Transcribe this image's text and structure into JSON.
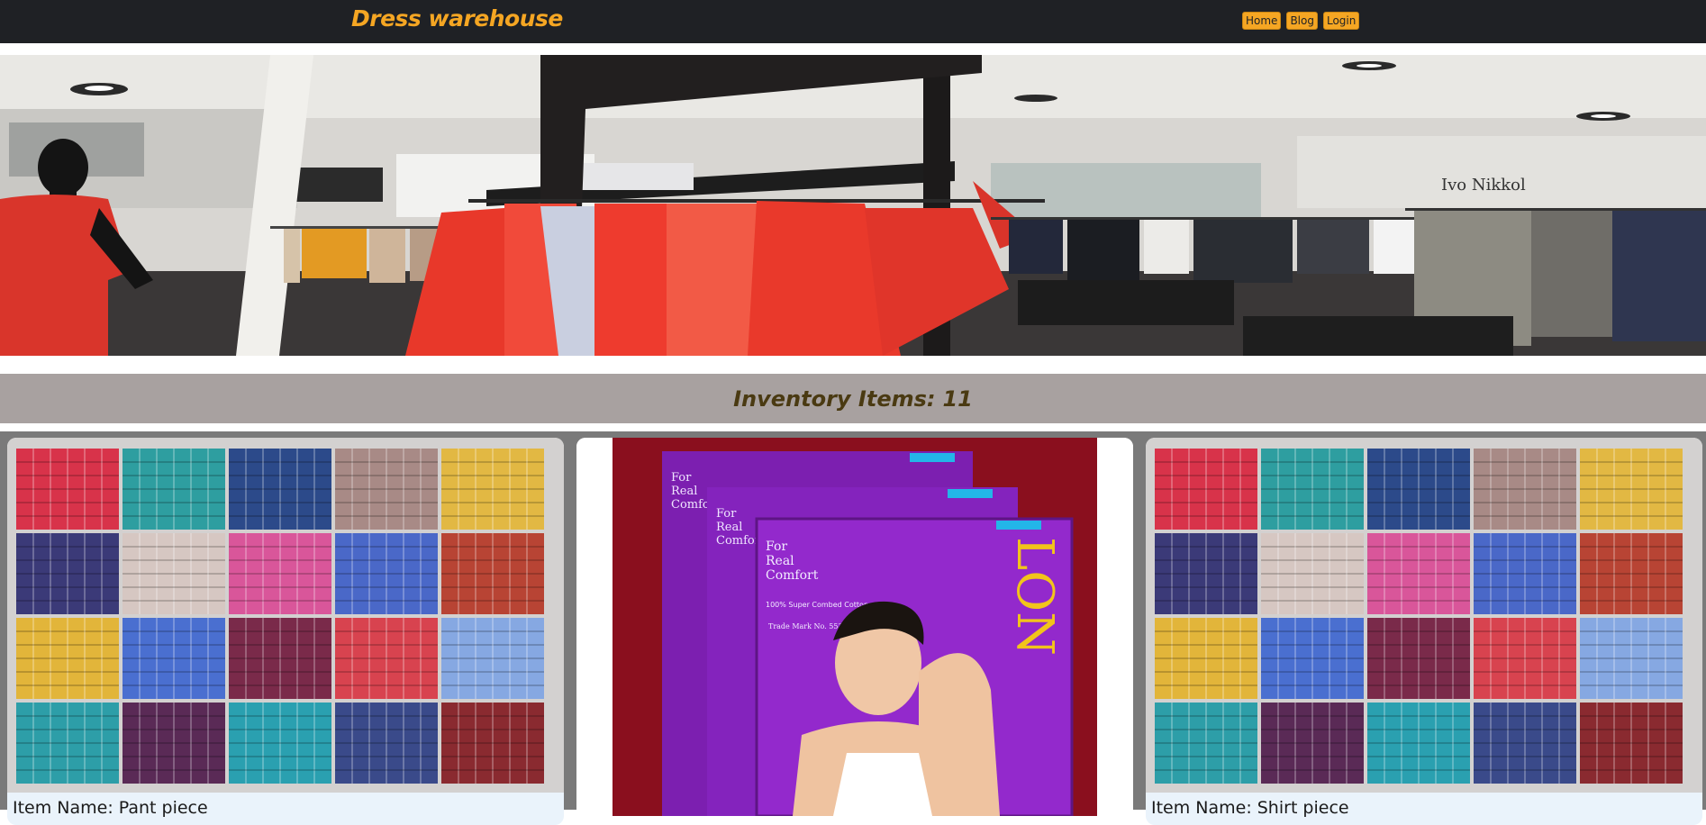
{
  "brand": "Dress warehouse",
  "nav": {
    "home": "Home",
    "blog": "Blog",
    "login": "Login"
  },
  "hero": {
    "store_sign": "Ivo Nikkolo"
  },
  "inventory": {
    "label": "Inventory Items:",
    "count": "11"
  },
  "items": [
    {
      "caption_label": "Item Name:",
      "name": "Pant piece"
    },
    {
      "caption_label": "",
      "name": "",
      "box_text_1": "For",
      "box_text_2": "Real",
      "box_text_3": "Comfort",
      "box_text_4": "100% Super Combed Cotton",
      "box_text_5": "Trade Mark No. 55366",
      "box_brand": "LON"
    },
    {
      "caption_label": "Item Name:",
      "name": "Shirt piece"
    }
  ],
  "colors": {
    "navbar_bg": "#1f2125",
    "accent": "#f5a623",
    "inventory_bar": "#a8a1a0",
    "inventory_text": "#4a3a12",
    "grid_bg": "#7a7a7a"
  }
}
